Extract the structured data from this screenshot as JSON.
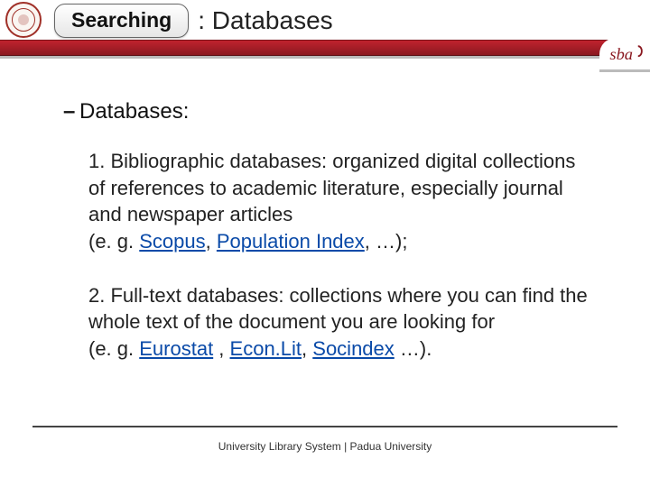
{
  "header": {
    "tab_label": "Searching",
    "title_suffix": ": Databases",
    "logo_text": "sba"
  },
  "content": {
    "bullet_dash": "–",
    "bullet_label": "Databases:",
    "para1": {
      "lead": "1. Bibliographic databases:  organized digital collections of references to academic literature, especially journal and newspaper articles",
      "eg_prefix": "(e. g. ",
      "link1": "Scopus",
      "sep1": ", ",
      "link2": "Population Index",
      "tail": ", …);"
    },
    "para2": {
      "lead": "2.  Full-text databases: collections where you can find the whole text of the document you are looking for",
      "eg_prefix": "(e. g. ",
      "link1": "Eurostat",
      "sep1": " ,  ",
      "link2": "Econ.Lit",
      "sep2": ", ",
      "link3": "Socindex",
      "tail": " …)."
    }
  },
  "footer": "University Library System | Padua University"
}
